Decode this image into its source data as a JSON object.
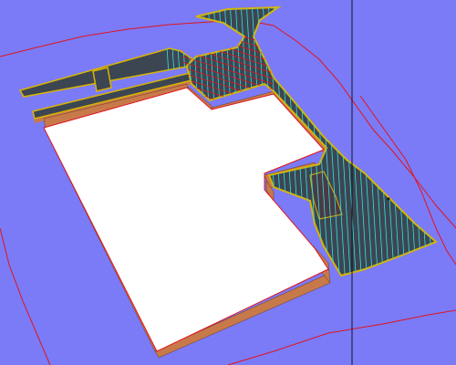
{
  "viewport": {
    "background_color": "#7b7bf7",
    "pad_fill_color": "#ffffff",
    "pad_side_color": "#c8794a",
    "road_surface_color": "#3c4652",
    "road_edge_color": "#d9b400",
    "boundary_line_color": "#e0141e",
    "hatch_line_color": "#30e3e3",
    "crosshair_color": "#111122"
  }
}
